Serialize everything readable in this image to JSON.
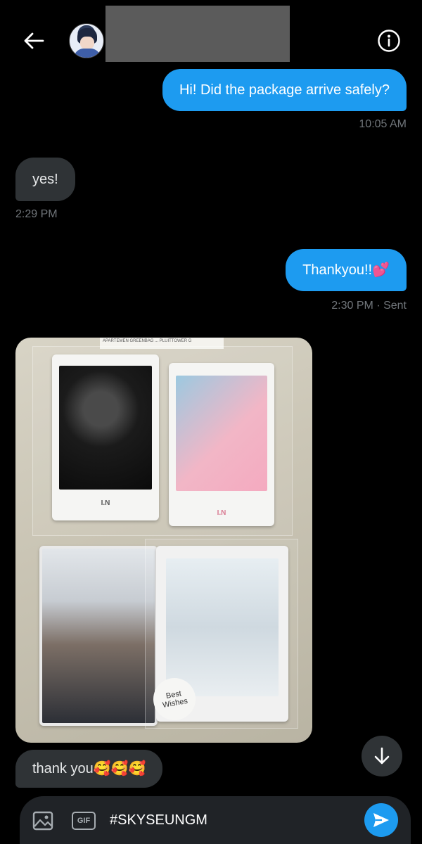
{
  "header": {
    "back_icon": "arrow-left-icon",
    "info_icon": "info-circle-icon"
  },
  "messages": [
    {
      "text": "Hi! Did the package arrive safely?",
      "direction": "sent",
      "meta": "10:05 AM"
    },
    {
      "text": "yes!",
      "direction": "received",
      "meta": "2:29 PM"
    },
    {
      "text": "Thankyou!!💕",
      "direction": "sent",
      "meta": "2:30 PM · Sent"
    },
    {
      "text": "thank you🥰🥰🥰",
      "direction": "received"
    }
  ],
  "photo": {
    "label_strip": "APARTEMEN GREENBAG ... PLUITTOWER G",
    "card_brand": "I.N",
    "sticker": "Best Wishes"
  },
  "composer": {
    "gif_label": "GIF",
    "input_value": "#SKYSEUNGM"
  },
  "colors": {
    "background": "#000000",
    "sent_bubble": "#1d9bf0",
    "received_bubble": "#2f3336",
    "meta_text": "#71767b",
    "composer_bg": "#202327"
  }
}
